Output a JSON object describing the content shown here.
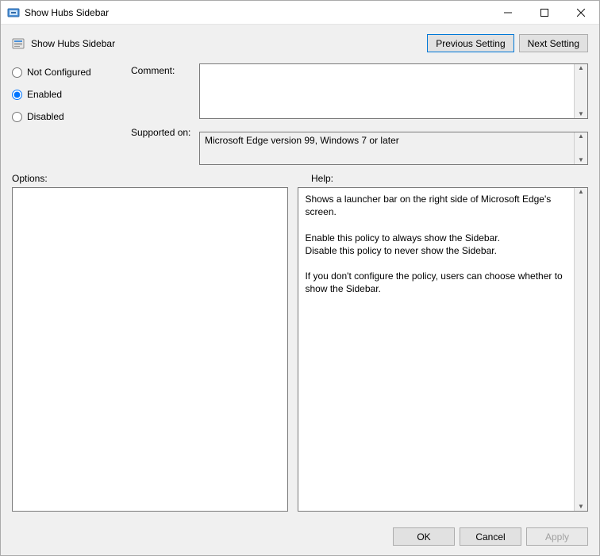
{
  "window": {
    "title": "Show Hubs Sidebar"
  },
  "header": {
    "policy_name": "Show Hubs Sidebar",
    "prev_btn": "Previous Setting",
    "next_btn": "Next Setting"
  },
  "radios": {
    "not_configured": "Not Configured",
    "enabled": "Enabled",
    "disabled": "Disabled",
    "selected": "enabled"
  },
  "fields": {
    "comment_label": "Comment:",
    "comment_value": "",
    "supported_label": "Supported on:",
    "supported_value": "Microsoft Edge version 99, Windows 7 or later"
  },
  "lower": {
    "options_label": "Options:",
    "help_label": "Help:",
    "help_text": "Shows a launcher bar on the right side of Microsoft Edge's screen.\n\nEnable this policy to always show the Sidebar.\nDisable this policy to never show the Sidebar.\n\nIf you don't configure the policy, users can choose whether to show the Sidebar."
  },
  "footer": {
    "ok": "OK",
    "cancel": "Cancel",
    "apply": "Apply"
  }
}
